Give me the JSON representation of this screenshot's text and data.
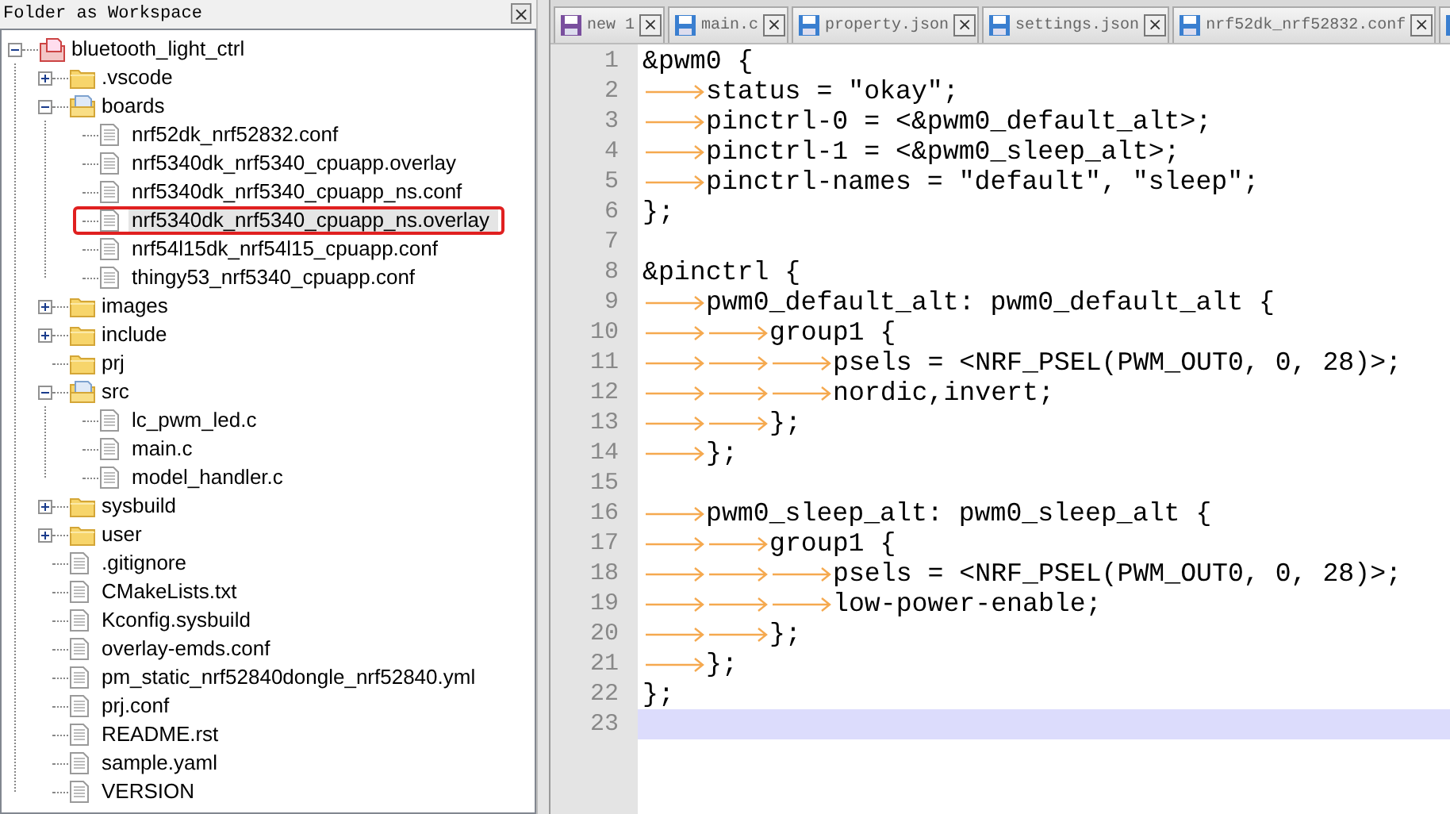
{
  "panel": {
    "title": "Folder as Workspace",
    "close": "×",
    "tree": [
      {
        "label": "bluetooth_light_ctrl",
        "kind": "project",
        "expanded": true,
        "children": [
          {
            "label": ".vscode",
            "kind": "folder",
            "expanded": false,
            "collapsible": true
          },
          {
            "label": "boards",
            "kind": "folder",
            "expanded": true,
            "collapsible": true,
            "children": [
              {
                "label": "nrf52dk_nrf52832.conf",
                "kind": "file",
                "selected": false,
                "marked": false
              },
              {
                "label": "nrf5340dk_nrf5340_cpuapp.overlay",
                "kind": "file",
                "selected": false,
                "marked": false
              },
              {
                "label": "nrf5340dk_nrf5340_cpuapp_ns.conf",
                "kind": "file",
                "selected": false,
                "marked": false
              },
              {
                "label": "nrf5340dk_nrf5340_cpuapp_ns.overlay",
                "kind": "file",
                "selected": true,
                "marked": true
              },
              {
                "label": "nrf54l15dk_nrf54l15_cpuapp.conf",
                "kind": "file",
                "selected": false,
                "marked": false
              },
              {
                "label": "thingy53_nrf5340_cpuapp.conf",
                "kind": "file",
                "selected": false,
                "marked": false
              }
            ]
          },
          {
            "label": "images",
            "kind": "folder",
            "expanded": false,
            "collapsible": true
          },
          {
            "label": "include",
            "kind": "folder",
            "expanded": false,
            "collapsible": true
          },
          {
            "label": "prj",
            "kind": "folder",
            "expanded": false,
            "collapsible": false
          },
          {
            "label": "src",
            "kind": "folder",
            "expanded": true,
            "collapsible": true,
            "children": [
              {
                "label": "lc_pwm_led.c",
                "kind": "file",
                "selected": false,
                "marked": false
              },
              {
                "label": "main.c",
                "kind": "file",
                "selected": false,
                "marked": false
              },
              {
                "label": "model_handler.c",
                "kind": "file",
                "selected": false,
                "marked": false
              }
            ]
          },
          {
            "label": "sysbuild",
            "kind": "folder",
            "expanded": false,
            "collapsible": true
          },
          {
            "label": "user",
            "kind": "folder",
            "expanded": false,
            "collapsible": true
          },
          {
            "label": ".gitignore",
            "kind": "file",
            "selected": false,
            "marked": false
          },
          {
            "label": "CMakeLists.txt",
            "kind": "file",
            "selected": false,
            "marked": false
          },
          {
            "label": "Kconfig.sysbuild",
            "kind": "file",
            "selected": false,
            "marked": false
          },
          {
            "label": "overlay-emds.conf",
            "kind": "file",
            "selected": false,
            "marked": false
          },
          {
            "label": "pm_static_nrf52840dongle_nrf52840.yml",
            "kind": "file",
            "selected": false,
            "marked": false
          },
          {
            "label": "prj.conf",
            "kind": "file",
            "selected": false,
            "marked": false
          },
          {
            "label": "README.rst",
            "kind": "file",
            "selected": false,
            "marked": false
          },
          {
            "label": "sample.yaml",
            "kind": "file",
            "selected": false,
            "marked": false
          },
          {
            "label": "VERSION",
            "kind": "file",
            "selected": false,
            "marked": false
          }
        ]
      }
    ]
  },
  "tabs": [
    {
      "label": "new 1",
      "color": "#7a4f9e",
      "close": "×"
    },
    {
      "label": "main.c",
      "color": "#3a7fd0",
      "close": "×"
    },
    {
      "label": "property.json",
      "color": "#3a7fd0",
      "close": "×"
    },
    {
      "label": "settings.json",
      "color": "#3a7fd0",
      "close": "×"
    },
    {
      "label": "nrf52dk_nrf52832.conf",
      "color": "#3a7fd0",
      "close": "×"
    }
  ],
  "editor": {
    "lines": [
      {
        "number": "1",
        "text": "&pwm0 {",
        "selected": false
      },
      {
        "number": "2",
        "text": "\tstatus = \"okay\";",
        "selected": false
      },
      {
        "number": "3",
        "text": "\tpinctrl-0 = <&pwm0_default_alt>;",
        "selected": false
      },
      {
        "number": "4",
        "text": "\tpinctrl-1 = <&pwm0_sleep_alt>;",
        "selected": false
      },
      {
        "number": "5",
        "text": "\tpinctrl-names = \"default\", \"sleep\";",
        "selected": false
      },
      {
        "number": "6",
        "text": "};",
        "selected": false
      },
      {
        "number": "7",
        "selected": false
      },
      {
        "number": "8",
        "text": "&pinctrl {",
        "selected": false
      },
      {
        "number": "9",
        "text": "\tpwm0_default_alt: pwm0_default_alt {",
        "selected": false
      },
      {
        "number": "10",
        "text": "\t\tgroup1 {",
        "selected": false
      },
      {
        "number": "11",
        "text": "\t\t\tpsels = <NRF_PSEL(PWM_OUT0, 0, 28)>;",
        "selected": false
      },
      {
        "number": "12",
        "text": "\t\t\tnordic,invert;",
        "selected": false
      },
      {
        "number": "13",
        "text": "\t\t};",
        "selected": false
      },
      {
        "number": "14",
        "text": "\t};",
        "selected": false
      },
      {
        "number": "15",
        "selected": false
      },
      {
        "number": "16",
        "text": "\tpwm0_sleep_alt: pwm0_sleep_alt {",
        "selected": false
      },
      {
        "number": "17",
        "text": "\t\tgroup1 {",
        "selected": false
      },
      {
        "number": "18",
        "text": "\t\t\tpsels = <NRF_PSEL(PWM_OUT0, 0, 28)>;",
        "selected": false
      },
      {
        "number": "19",
        "text": "\t\t\tlow-power-enable;",
        "selected": false
      },
      {
        "number": "20",
        "text": "\t\t};",
        "selected": false
      },
      {
        "number": "21",
        "text": "\t};",
        "selected": false
      },
      {
        "number": "22",
        "text": "};",
        "selected": false
      },
      {
        "number": "23",
        "selected": true
      }
    ]
  }
}
